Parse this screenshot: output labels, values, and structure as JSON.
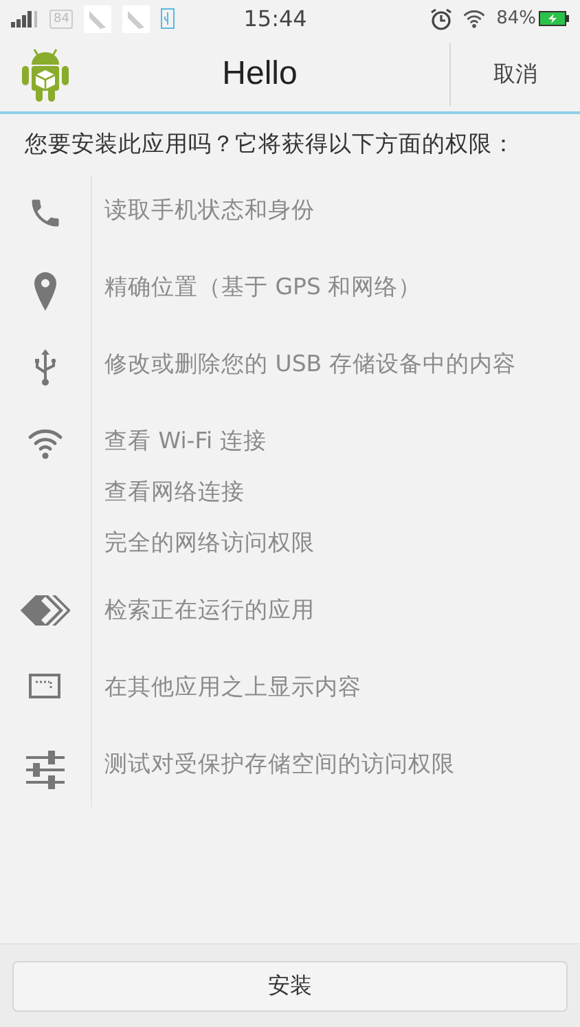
{
  "status_bar": {
    "notification_count": "84",
    "time": "15:44",
    "battery": "84%"
  },
  "header": {
    "title": "Hello",
    "cancel": "取消"
  },
  "intro": "您要安装此应用吗？它将获得以下方面的权限：",
  "permissions": [
    {
      "kind": "phone",
      "lines": [
        "读取手机状态和身份"
      ]
    },
    {
      "kind": "location",
      "lines": [
        "精确位置（基于 GPS 和网络）"
      ]
    },
    {
      "kind": "usb",
      "lines": [
        "修改或删除您的 USB 存储设备中的内容"
      ]
    },
    {
      "kind": "wifi",
      "lines": [
        "查看 Wi-Fi 连接",
        "查看网络连接",
        "完全的网络访问权限"
      ]
    },
    {
      "kind": "apps",
      "lines": [
        "检索正在运行的应用"
      ]
    },
    {
      "kind": "overlay",
      "lines": [
        "在其他应用之上显示内容"
      ]
    },
    {
      "kind": "sliders",
      "lines": [
        "测试对受保护存储空间的访问权限"
      ]
    }
  ],
  "install_button": "安装"
}
